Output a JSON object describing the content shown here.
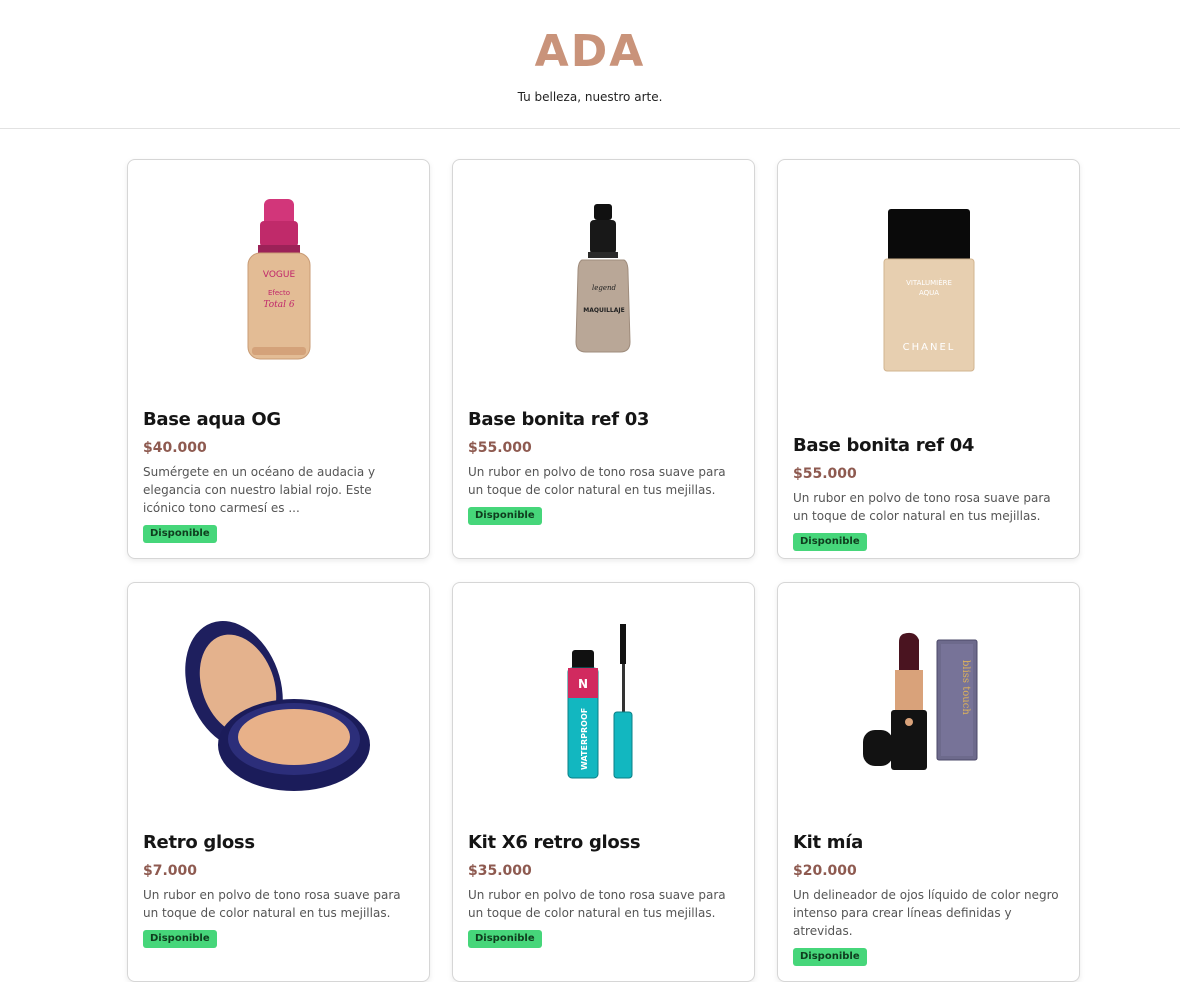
{
  "header": {
    "brand": "ADA",
    "tagline": "Tu belleza, nuestro arte."
  },
  "products": [
    {
      "name": "Base aqua OG",
      "price": "$40.000",
      "description": "Sumérgete en un océano de audacia y elegancia con nuestro labial rojo. Este icónico tono carmesí es ...",
      "status": "Disponible",
      "image_icon": "foundation-bottle-pink-icon",
      "image_text": [
        "VOGUE",
        "Efecto",
        "Total 6"
      ]
    },
    {
      "name": "Base bonita ref 03",
      "price": "$55.000",
      "description": "Un rubor en polvo de tono rosa suave para un toque de color natural en tus mejillas.",
      "status": "Disponible",
      "image_icon": "foundation-pump-bottle-icon",
      "image_text": [
        "legend",
        "MAQUILLAJE"
      ]
    },
    {
      "name": "Base bonita ref 04",
      "price": "$55.000",
      "description": "Un rubor en polvo de tono rosa suave para un toque de color natural en tus mejillas.",
      "status": "Disponible",
      "image_icon": "foundation-square-bottle-icon",
      "image_text": [
        "VITALUMIÈRE",
        "AQUA",
        "CHANEL"
      ]
    },
    {
      "name": "Retro gloss",
      "price": "$7.000",
      "description": "Un rubor en polvo de tono rosa suave para un toque de color natural en tus mejillas.",
      "status": "Disponible",
      "image_icon": "compact-powder-icon",
      "image_text": []
    },
    {
      "name": "Kit X6 retro gloss",
      "price": "$35.000",
      "description": "Un rubor en polvo de tono rosa suave para un toque de color natural en tus mejillas.",
      "status": "Disponible",
      "image_icon": "mascara-icon",
      "image_text": [
        "WATERPROOF",
        "N"
      ]
    },
    {
      "name": "Kit mía",
      "price": "$20.000",
      "description": "Un delineador de ojos líquido de color negro intenso para crear líneas definidas y atrevidas.",
      "status": "Disponible",
      "image_icon": "lipstick-box-icon",
      "image_text": [
        "bliss touch"
      ]
    }
  ]
}
